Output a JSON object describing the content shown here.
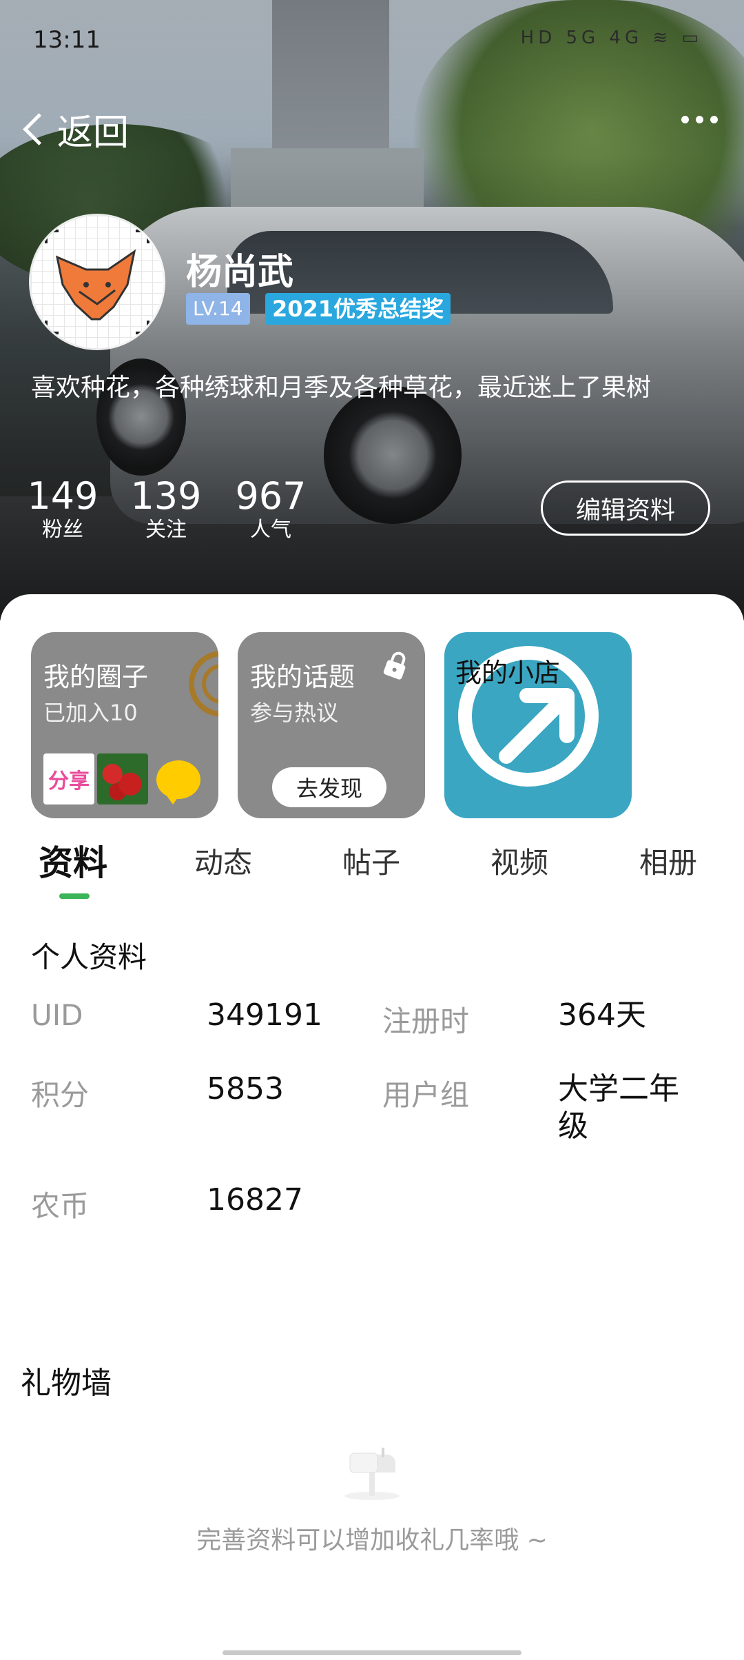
{
  "status_bar": {
    "time": "13:11",
    "icons": "HD 5G 4G ≋ ▭"
  },
  "header": {
    "back_label": "返回"
  },
  "profile": {
    "username": "杨尚武",
    "level": "LV.14",
    "award": "2021优秀总结奖",
    "bio": "喜欢种花，各种绣球和月季及各种草花，最近迷上了果树",
    "stats": [
      {
        "value": "149",
        "label": "粉丝"
      },
      {
        "value": "139",
        "label": "关注"
      },
      {
        "value": "967",
        "label": "人气"
      }
    ],
    "edit_button": "编辑资料"
  },
  "cards": {
    "circles": {
      "title": "我的圈子",
      "subtitle": "已加入10",
      "thumb_share": "分享"
    },
    "topics": {
      "title": "我的话题",
      "subtitle": "参与热议",
      "button": "去发现"
    },
    "shop": {
      "title": "我的小店"
    }
  },
  "tabs": [
    "资料",
    "动态",
    "帖子",
    "视频",
    "相册"
  ],
  "personal_info": {
    "title": "个人资料",
    "fields": [
      {
        "label": "UID",
        "value": "349191"
      },
      {
        "label": "注册时",
        "value": "364天"
      },
      {
        "label": "积分",
        "value": "5853"
      },
      {
        "label": "用户组",
        "value": "大学二年级"
      },
      {
        "label": "农币",
        "value": "16827"
      }
    ]
  },
  "gift_wall": {
    "title": "礼物墙",
    "empty_text": "完善资料可以增加收礼几率哦 ~"
  },
  "colors": {
    "accent_green": "#3cb55a",
    "award_blue": "#2aa7de",
    "level_blue": "#8fb4e7"
  }
}
